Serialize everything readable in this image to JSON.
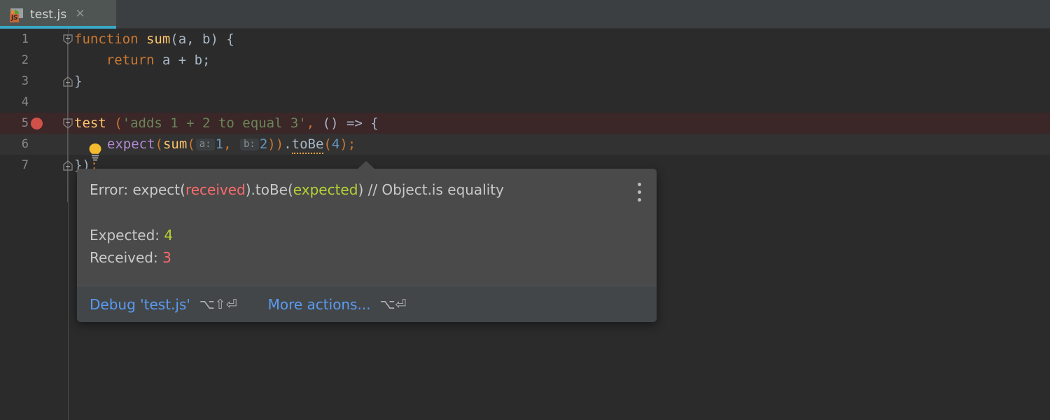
{
  "window": {
    "accent_tab_underline": "#3ba6c4",
    "editor_bg": "#2b2b2b",
    "tabbar_bg": "#3c3f41"
  },
  "tabbar": {
    "tab": {
      "title": "test.js",
      "icon": "javascript-file-icon",
      "icon_badge": "JS",
      "close_glyph": "✕",
      "active": true
    }
  },
  "editor": {
    "gutter": {
      "line_numbers": [
        "1",
        "2",
        "3",
        "4",
        "5",
        "6",
        "7"
      ],
      "breakpoint_line": "5",
      "fold_lines": [
        "1",
        "3",
        "5",
        "7"
      ]
    },
    "intention_icon": "lightbulb-icon",
    "lines": [
      {
        "number": "1",
        "tokens": [
          {
            "t": "function",
            "c": "kw"
          },
          {
            "t": " ",
            "c": "plain"
          },
          {
            "t": "sum",
            "c": "fn"
          },
          {
            "t": "(a, b) {",
            "c": "plain"
          }
        ]
      },
      {
        "number": "2",
        "tokens": [
          {
            "t": "    ",
            "c": "plain"
          },
          {
            "t": "return",
            "c": "kw"
          },
          {
            "t": " a + b;",
            "c": "plain"
          }
        ]
      },
      {
        "number": "3",
        "tokens": [
          {
            "t": "}",
            "c": "plain"
          }
        ]
      },
      {
        "number": "4",
        "tokens": [
          {
            "t": "",
            "c": "plain"
          }
        ]
      },
      {
        "number": "5",
        "tokens": [
          {
            "t": "test",
            "c": "fn"
          },
          {
            "t": " ",
            "c": "plain"
          },
          {
            "t": "(",
            "c": "punc"
          },
          {
            "t": "'adds 1 + 2 to equal 3'",
            "c": "str"
          },
          {
            "t": ",",
            "c": "punc"
          },
          {
            "t": " () ",
            "c": "plain"
          },
          {
            "t": "=>",
            "c": "plain"
          },
          {
            "t": " {",
            "c": "plain"
          }
        ]
      },
      {
        "number": "6",
        "tokens": [
          {
            "t": "  ",
            "c": "plain"
          },
          {
            "t": "expect",
            "c": "func-pur"
          },
          {
            "t": "(",
            "c": "punc"
          },
          {
            "t": "sum",
            "c": "fn"
          },
          {
            "t": "(",
            "c": "punc"
          },
          {
            "t": "a:",
            "c": "hint"
          },
          {
            "t": "1",
            "c": "num"
          },
          {
            "t": ",",
            "c": "punc"
          },
          {
            "t": " ",
            "c": "plain"
          },
          {
            "t": "b:",
            "c": "hint"
          },
          {
            "t": "2",
            "c": "num"
          },
          {
            "t": "))",
            "c": "punc"
          },
          {
            "t": ".",
            "c": "plain"
          },
          {
            "t": "toBe",
            "c": "warn"
          },
          {
            "t": "(",
            "c": "punc"
          },
          {
            "t": "4",
            "c": "num"
          },
          {
            "t": ")",
            "c": "punc"
          },
          {
            "t": ";",
            "c": "punc"
          }
        ]
      },
      {
        "number": "7",
        "tokens": [
          {
            "t": "})",
            "c": "plain"
          },
          {
            "t": ";",
            "c": "punc"
          }
        ]
      }
    ]
  },
  "tooltip": {
    "header": {
      "prefix": "Error: expect(",
      "received_token": "received",
      "middle": ").toBe(",
      "expected_token": "expected",
      "suffix": ") // Object.is equality"
    },
    "kebab_icon": "more-options-icon",
    "rows": [
      {
        "label": "Expected:",
        "value": "4",
        "color": "#b5d334"
      },
      {
        "label": "Received:",
        "value": "3",
        "color": "#fc6a6a"
      }
    ],
    "footer": {
      "debug_label": "Debug 'test.js'",
      "debug_shortcut": "⌥⇧⏎",
      "more_label": "More actions...",
      "more_shortcut": "⌥⏎"
    }
  }
}
